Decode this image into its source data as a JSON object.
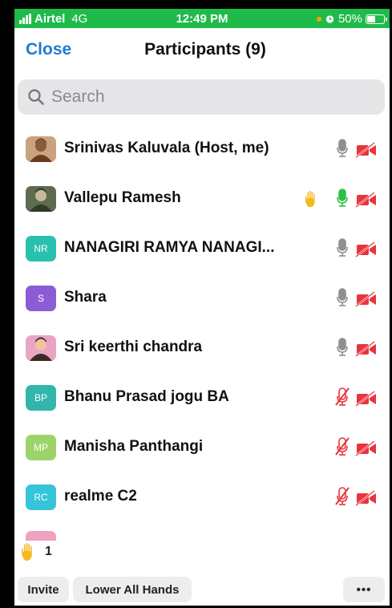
{
  "status_bar": {
    "carrier": "Airtel",
    "network": "4G",
    "time": "12:49 PM",
    "battery": "50%",
    "battery_level": 0.5
  },
  "header": {
    "close_label": "Close",
    "title": "Participants (9)"
  },
  "search": {
    "placeholder": "Search"
  },
  "participants": [
    {
      "name": "Srinivas Kaluvala (Host, me)",
      "avatar": "photo",
      "hand_raised": false,
      "mic": "on",
      "video": "off"
    },
    {
      "name": "Vallepu Ramesh",
      "avatar": "photo",
      "hand_raised": true,
      "mic": "speaking",
      "video": "off"
    },
    {
      "name": "NANAGIRI RAMYA NANAGI...",
      "avatar_initials": "NR",
      "avatar_color": "#2bbfb0",
      "hand_raised": false,
      "mic": "on",
      "video": "off"
    },
    {
      "name": "Shara",
      "avatar_initials": "S",
      "avatar_color": "#8b5cd6",
      "hand_raised": false,
      "mic": "on",
      "video": "off"
    },
    {
      "name": "Sri keerthi chandra",
      "avatar": "photo",
      "hand_raised": false,
      "mic": "on",
      "video": "off"
    },
    {
      "name": "Bhanu Prasad jogu BA",
      "avatar_initials": "BP",
      "avatar_color": "#32b5aa",
      "hand_raised": false,
      "mic": "muted",
      "video": "off"
    },
    {
      "name": "Manisha Panthangi",
      "avatar_initials": "MP",
      "avatar_color": "#9ed36a",
      "hand_raised": false,
      "mic": "muted",
      "video": "off"
    },
    {
      "name": "realme C2",
      "avatar_initials": "RC",
      "avatar_color": "#35c4d9",
      "hand_raised": false,
      "mic": "muted",
      "video": "off"
    }
  ],
  "footer": {
    "raised_hands_count": "1",
    "invite_label": "Invite",
    "lower_all_label": "Lower All Hands",
    "more_label": "•••"
  },
  "colors": {
    "status_bar": "#1fbb4a",
    "accent": "#1e7ad6",
    "muted_red": "#e8343c",
    "speaking_green": "#2cc24a",
    "hand_yellow": "#f6b821"
  },
  "icons": [
    "signal-icon",
    "alarm-icon",
    "battery-icon",
    "search-icon",
    "raise-hand-icon",
    "microphone-icon",
    "microphone-muted-icon",
    "video-off-icon"
  ]
}
